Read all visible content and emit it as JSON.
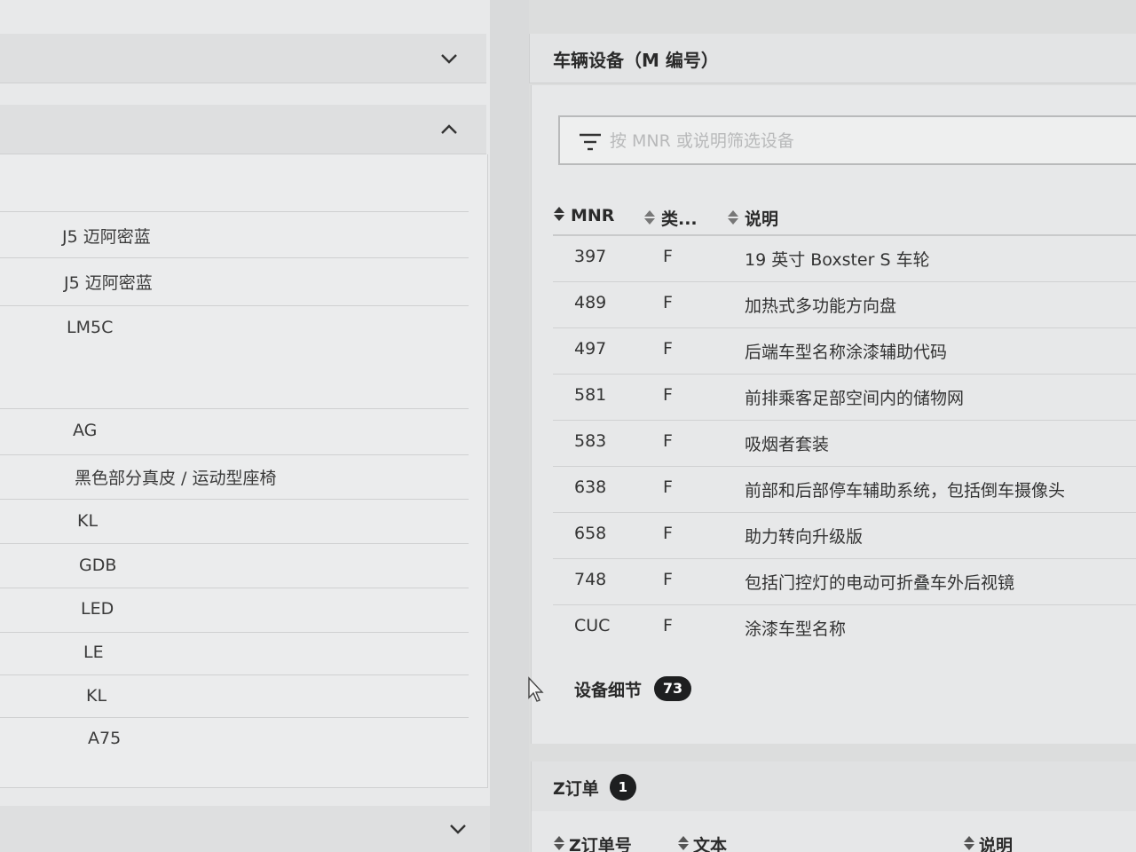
{
  "left": {
    "items": [
      "J5 迈阿密蓝",
      "J5 迈阿密蓝",
      "LM5C",
      "AG",
      "黑色部分真皮 / 运动型座椅",
      "KL",
      "GDB",
      "LED",
      "LE",
      "KL",
      "A75"
    ]
  },
  "right": {
    "title": "车辆设备（M 编号）",
    "filter": {
      "placeholder": "按 MNR 或说明筛选设备"
    },
    "columns": {
      "mnr": "MNR",
      "type": "类...",
      "desc": "说明"
    },
    "rows": [
      {
        "mnr": "397",
        "type": "F",
        "desc": "19 英寸 Boxster S 车轮"
      },
      {
        "mnr": "489",
        "type": "F",
        "desc": "加热式多功能方向盘"
      },
      {
        "mnr": "497",
        "type": "F",
        "desc": "后端车型名称涂漆辅助代码"
      },
      {
        "mnr": "581",
        "type": "F",
        "desc": "前排乘客足部空间内的储物网"
      },
      {
        "mnr": "583",
        "type": "F",
        "desc": "吸烟者套装"
      },
      {
        "mnr": "638",
        "type": "F",
        "desc": "前部和后部停车辅助系统，包括倒车摄像头"
      },
      {
        "mnr": "658",
        "type": "F",
        "desc": "助力转向升级版"
      },
      {
        "mnr": "748",
        "type": "F",
        "desc": "包括门控灯的电动可折叠车外后视镜"
      },
      {
        "mnr": "CUC",
        "type": "F",
        "desc": "涂漆车型名称"
      }
    ],
    "details": {
      "label": "设备细节",
      "count": "73"
    }
  },
  "zorder": {
    "title": "Z订单",
    "count": "1",
    "columns": {
      "number": "Z订单号",
      "text": "文本",
      "desc": "说明"
    }
  },
  "icons": {
    "chevron_down": "chevron-down-icon",
    "chevron_up": "chevron-up-icon",
    "filter": "filter-icon",
    "sort": "sort-icon",
    "cursor": "mouse-cursor-icon"
  }
}
